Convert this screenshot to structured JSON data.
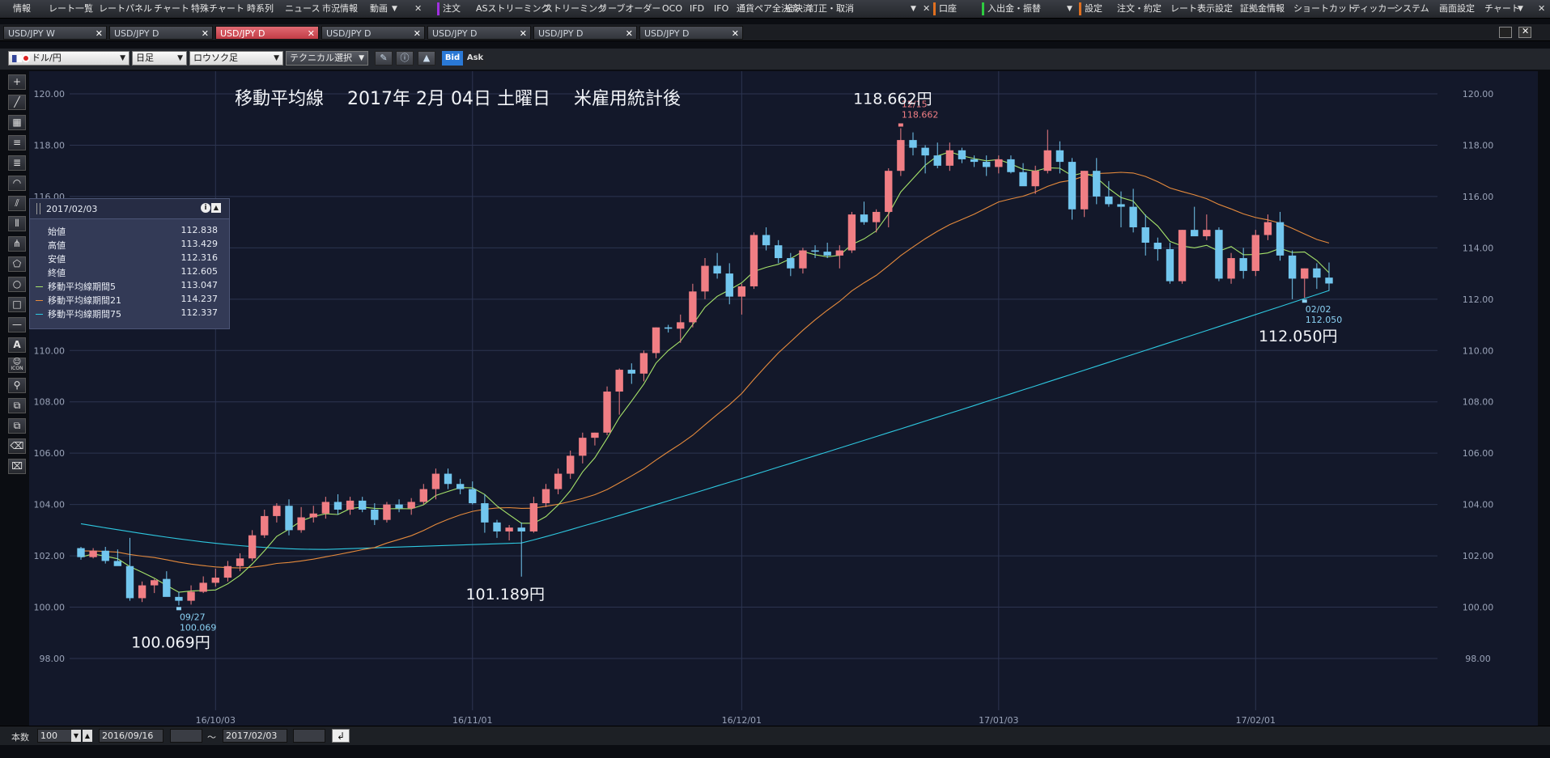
{
  "menu": {
    "items": [
      "情報",
      "レート一覧",
      "レートパネル",
      "チャート",
      "特殊チャート",
      "時系列",
      "ニュース",
      "市況情報",
      "動画",
      "注文",
      "ASストリーミング",
      "ストリーミング",
      "リーブオーダー",
      "OCO",
      "IFD",
      "IFO",
      "通貨ペア全決済",
      "全決済",
      "訂正・取消",
      "口座",
      "入出金・振替",
      "設定",
      "注文・約定",
      "レート表示設定",
      "証拠金情報",
      "ショートカット",
      "ティッカー",
      "システム",
      "画面設定",
      "チャート"
    ]
  },
  "tabs": [
    {
      "label": "USD/JPY W",
      "active": false
    },
    {
      "label": "USD/JPY D",
      "active": false
    },
    {
      "label": "USD/JPY D",
      "active": true
    },
    {
      "label": "USD/JPY D",
      "active": false
    },
    {
      "label": "USD/JPY D",
      "active": false
    },
    {
      "label": "USD/JPY D",
      "active": false
    },
    {
      "label": "USD/JPY D",
      "active": false
    }
  ],
  "toolbar": {
    "currency": "ドル/円",
    "period": "日足",
    "chart_style": "ロウソク足",
    "technical": "テクニカル選択",
    "bid": "Bid",
    "ask": "Ask"
  },
  "left_tools": [
    "crosshair-icon",
    "trendline-icon",
    "ruler-icon",
    "horizontal-lines-icon",
    "channel-icon",
    "arc-icon",
    "fan-icon",
    "vertical-lines-icon",
    "pitchfork-icon",
    "pentagon-icon",
    "circle-icon",
    "rectangle-icon",
    "line-icon",
    "text-icon",
    "smiley-icon",
    "magnet-icon",
    "copy-icon",
    "duplicate-icon",
    "eraser-icon",
    "clear-all-icon"
  ],
  "tool_labels": {
    "text": "A",
    "icon": "ICON"
  },
  "info_panel": {
    "date": "2017/02/03",
    "rows": [
      {
        "label": "始値",
        "value": "112.838"
      },
      {
        "label": "高値",
        "value": "113.429"
      },
      {
        "label": "安値",
        "value": "112.316"
      },
      {
        "label": "終値",
        "value": "112.605"
      },
      {
        "label": "移動平均線期間5",
        "value": "113.047",
        "color": "#a6e36a"
      },
      {
        "label": "移動平均線期間21",
        "value": "114.237",
        "color": "#e58a3c"
      },
      {
        "label": "移動平均線期間75",
        "value": "112.337",
        "color": "#2ec8e0"
      }
    ]
  },
  "status": {
    "count_label": "本数",
    "count_value": "100",
    "start_date": "2016/09/16",
    "tilde": "～",
    "end_date": "2017/02/03"
  },
  "chart_data": {
    "type": "candlestick",
    "title": "移動平均線　 2017年 2月 04日 土曜日　 米雇用統計後",
    "ylim": [
      98,
      120.5
    ],
    "y_ticks": [
      "98.00",
      "100.00",
      "102.00",
      "104.00",
      "106.00",
      "108.00",
      "110.00",
      "112.00",
      "114.00",
      "116.00",
      "118.00",
      "120.00"
    ],
    "x_ticks": [
      {
        "label": "16/10/03",
        "index": 11
      },
      {
        "label": "16/11/01",
        "index": 32
      },
      {
        "label": "16/12/01",
        "index": 54
      },
      {
        "label": "17/01/03",
        "index": 75
      },
      {
        "label": "17/02/01",
        "index": 96
      }
    ],
    "colors": {
      "up": "#f07e84",
      "down": "#72c6ee",
      "ma5": "#a6e36a",
      "ma21": "#e58a3c",
      "ma75": "#2ec8e0"
    },
    "candles": [
      [
        102.3,
        102.35,
        101.85,
        101.95
      ],
      [
        101.95,
        102.3,
        101.9,
        102.2
      ],
      [
        102.2,
        102.35,
        101.7,
        101.8
      ],
      [
        101.8,
        102.25,
        101.65,
        101.6
      ],
      [
        101.6,
        102.7,
        100.25,
        100.35
      ],
      [
        100.35,
        101.0,
        100.2,
        100.85
      ],
      [
        100.85,
        101.1,
        100.55,
        101.05
      ],
      [
        101.1,
        101.4,
        100.85,
        100.4
      ],
      [
        100.4,
        100.6,
        100.07,
        100.25
      ],
      [
        100.25,
        100.85,
        100.1,
        100.6
      ],
      [
        100.6,
        101.2,
        100.55,
        100.95
      ],
      [
        100.95,
        101.5,
        100.8,
        101.15
      ],
      [
        101.15,
        101.8,
        101.0,
        101.6
      ],
      [
        101.6,
        102.1,
        101.4,
        101.9
      ],
      [
        101.9,
        103.0,
        101.8,
        102.8
      ],
      [
        102.8,
        103.8,
        102.7,
        103.55
      ],
      [
        103.55,
        104.05,
        103.3,
        103.95
      ],
      [
        103.95,
        104.2,
        102.8,
        103.0
      ],
      [
        103.0,
        103.9,
        102.9,
        103.5
      ],
      [
        103.5,
        103.95,
        103.3,
        103.65
      ],
      [
        103.65,
        104.3,
        103.45,
        104.1
      ],
      [
        104.1,
        104.4,
        103.6,
        103.8
      ],
      [
        103.8,
        104.3,
        103.6,
        104.15
      ],
      [
        104.15,
        104.3,
        103.7,
        103.8
      ],
      [
        103.8,
        104.05,
        103.2,
        103.4
      ],
      [
        103.4,
        104.1,
        103.3,
        104.0
      ],
      [
        104.0,
        104.2,
        103.7,
        103.85
      ],
      [
        103.85,
        104.25,
        103.6,
        104.1
      ],
      [
        104.1,
        104.8,
        104.0,
        104.6
      ],
      [
        104.6,
        105.4,
        104.2,
        105.2
      ],
      [
        105.2,
        105.4,
        104.6,
        104.8
      ],
      [
        104.8,
        105.0,
        104.4,
        104.6
      ],
      [
        104.6,
        104.9,
        104.0,
        104.05
      ],
      [
        104.05,
        104.4,
        102.9,
        103.3
      ],
      [
        103.3,
        103.4,
        102.7,
        102.95
      ],
      [
        102.95,
        103.2,
        102.6,
        103.1
      ],
      [
        103.1,
        103.3,
        101.19,
        102.95
      ],
      [
        102.95,
        104.3,
        102.9,
        104.05
      ],
      [
        104.05,
        104.8,
        103.9,
        104.6
      ],
      [
        104.6,
        105.4,
        104.4,
        105.2
      ],
      [
        105.2,
        106.1,
        105.0,
        105.9
      ],
      [
        105.9,
        106.8,
        105.6,
        106.6
      ],
      [
        106.6,
        106.8,
        106.3,
        106.8
      ],
      [
        106.8,
        108.6,
        106.7,
        108.4
      ],
      [
        108.4,
        109.3,
        107.5,
        109.25
      ],
      [
        109.25,
        109.5,
        108.7,
        109.1
      ],
      [
        109.1,
        110.0,
        108.8,
        109.9
      ],
      [
        109.9,
        110.9,
        109.7,
        110.9
      ],
      [
        110.9,
        111.0,
        110.7,
        110.85
      ],
      [
        110.85,
        111.4,
        110.3,
        111.1
      ],
      [
        111.1,
        112.6,
        110.9,
        112.3
      ],
      [
        112.3,
        113.6,
        112.0,
        113.3
      ],
      [
        113.3,
        113.8,
        112.8,
        113.0
      ],
      [
        113.0,
        113.4,
        111.8,
        112.1
      ],
      [
        112.1,
        112.6,
        111.4,
        112.5
      ],
      [
        112.5,
        114.6,
        112.4,
        114.5
      ],
      [
        114.5,
        114.8,
        113.9,
        114.1
      ],
      [
        114.1,
        114.3,
        113.4,
        113.6
      ],
      [
        113.6,
        113.8,
        112.9,
        113.2
      ],
      [
        113.2,
        114.0,
        113.0,
        113.9
      ],
      [
        113.9,
        114.1,
        113.6,
        113.85
      ],
      [
        113.85,
        114.2,
        113.6,
        113.7
      ],
      [
        113.7,
        114.1,
        113.2,
        113.9
      ],
      [
        113.9,
        115.4,
        113.8,
        115.3
      ],
      [
        115.3,
        115.8,
        114.9,
        115.0
      ],
      [
        115.0,
        115.5,
        114.6,
        115.4
      ],
      [
        115.4,
        117.1,
        114.8,
        117.0
      ],
      [
        117.0,
        118.66,
        116.8,
        118.2
      ],
      [
        118.2,
        118.5,
        117.6,
        117.9
      ],
      [
        117.9,
        118.0,
        116.9,
        117.6
      ],
      [
        117.6,
        118.1,
        117.1,
        117.2
      ],
      [
        117.2,
        118.1,
        117.0,
        117.8
      ],
      [
        117.8,
        117.9,
        117.3,
        117.45
      ],
      [
        117.45,
        117.6,
        117.15,
        117.35
      ],
      [
        117.35,
        117.6,
        116.8,
        117.15
      ],
      [
        117.15,
        117.6,
        116.9,
        117.45
      ],
      [
        117.45,
        117.6,
        116.9,
        116.95
      ],
      [
        116.95,
        117.3,
        116.5,
        116.4
      ],
      [
        116.4,
        117.2,
        116.1,
        117.0
      ],
      [
        117.0,
        118.6,
        116.9,
        117.8
      ],
      [
        117.8,
        118.15,
        116.9,
        117.35
      ],
      [
        117.35,
        117.5,
        115.1,
        115.5
      ],
      [
        115.5,
        117.0,
        115.2,
        117.0
      ],
      [
        117.0,
        117.5,
        115.7,
        116.0
      ],
      [
        116.0,
        116.6,
        115.6,
        115.7
      ],
      [
        115.7,
        116.2,
        114.8,
        115.6
      ],
      [
        115.6,
        116.3,
        114.6,
        114.8
      ],
      [
        114.8,
        115.3,
        113.7,
        114.2
      ],
      [
        114.2,
        114.4,
        113.5,
        113.95
      ],
      [
        113.95,
        114.2,
        112.6,
        112.7
      ],
      [
        112.7,
        114.7,
        112.6,
        114.7
      ],
      [
        114.7,
        115.6,
        114.5,
        114.45
      ],
      [
        114.45,
        115.3,
        114.3,
        114.7
      ],
      [
        114.7,
        114.8,
        112.7,
        112.8
      ],
      [
        112.8,
        113.8,
        112.6,
        113.6
      ],
      [
        113.6,
        114.0,
        112.8,
        113.1
      ],
      [
        113.1,
        114.7,
        112.9,
        114.5
      ],
      [
        114.5,
        115.3,
        114.3,
        115.0
      ],
      [
        115.0,
        115.4,
        113.5,
        113.7
      ],
      [
        113.7,
        113.9,
        112.0,
        112.8
      ],
      [
        112.8,
        113.2,
        112.05,
        113.2
      ],
      [
        113.2,
        113.4,
        112.4,
        112.84
      ],
      [
        112.84,
        113.43,
        112.32,
        112.61
      ]
    ],
    "ma21_end": 114.237,
    "ma75_end": 112.337,
    "annotations": [
      {
        "date": "09/27",
        "value": "100.069",
        "index": 8,
        "price": 100.07,
        "side": "below",
        "color": "#8bd2f4"
      },
      {
        "date": "12/15",
        "value": "118.662",
        "index": 67,
        "price": 118.66,
        "side": "above",
        "color": "#f07e84"
      },
      {
        "date": "02/02",
        "value": "112.050",
        "index": 100,
        "price": 112.05,
        "side": "below",
        "color": "#8bd2f4"
      }
    ],
    "big_labels": [
      {
        "text": "100.069円",
        "index": 8,
        "price": 100.07
      },
      {
        "text": "101.189円",
        "index": 36,
        "price": 101.19
      },
      {
        "text": "118.662円",
        "index": 67,
        "price": 118.66
      },
      {
        "text": "112.050円",
        "index": 100,
        "price": 112.05
      }
    ]
  }
}
